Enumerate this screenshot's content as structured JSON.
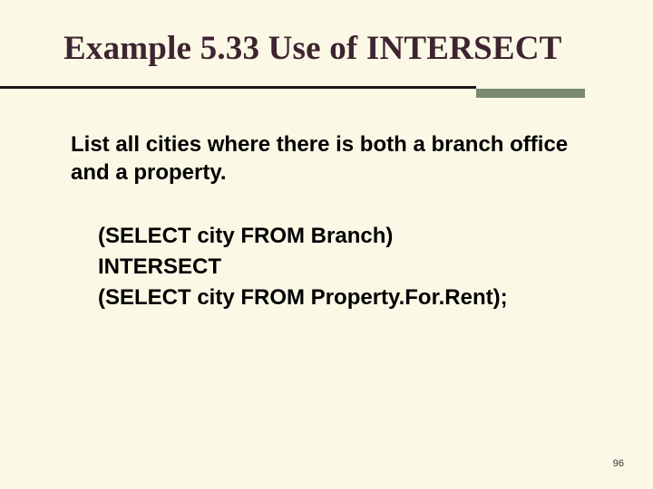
{
  "title": "Example 5.33  Use of INTERSECT",
  "body": "List all cities where there is both a branch office and a property.",
  "sql": {
    "line1": "(SELECT city FROM Branch)",
    "line2": "INTERSECT",
    "line3": "(SELECT city FROM Property.For.Rent);"
  },
  "page_number": "96"
}
